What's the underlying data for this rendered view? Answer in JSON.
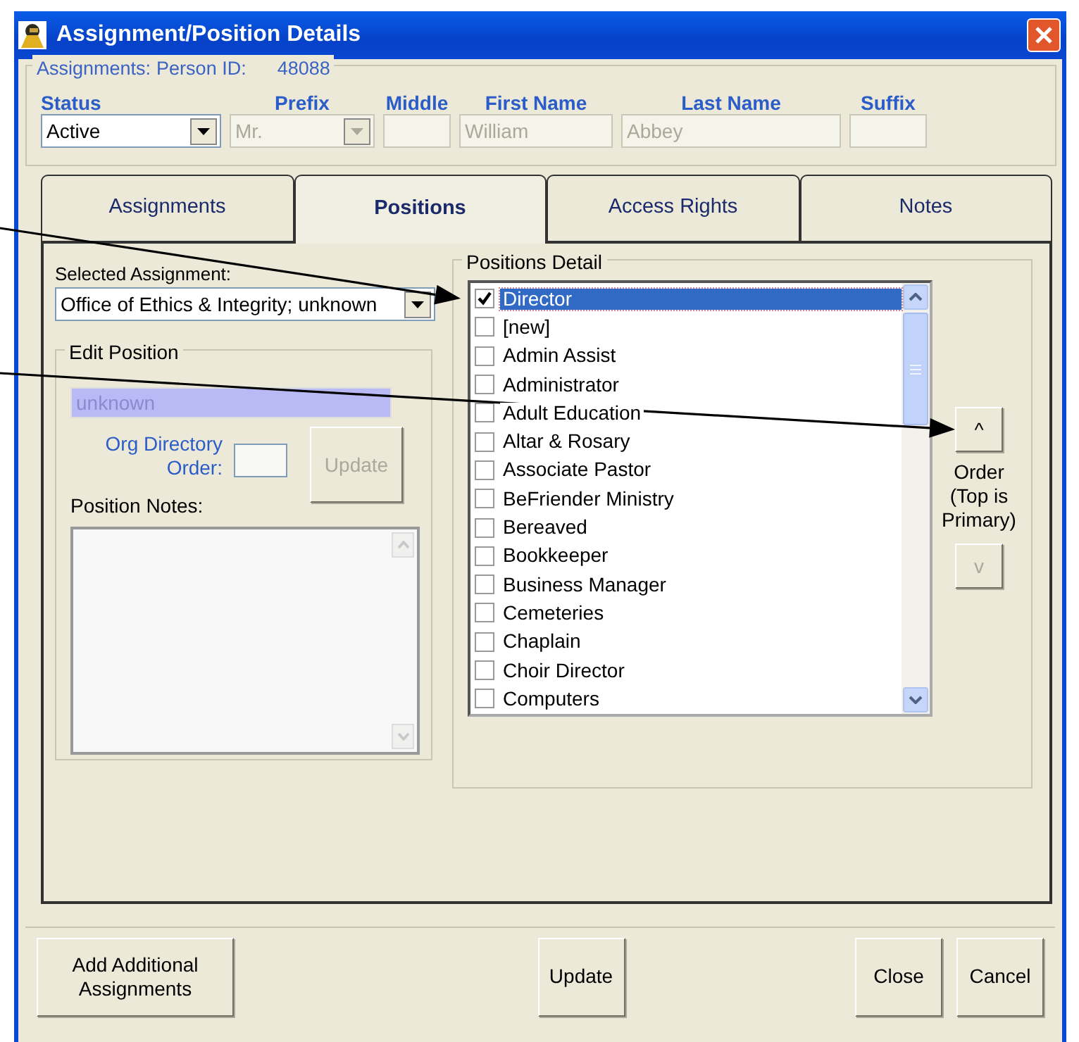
{
  "window": {
    "title": "Assignment/Position Details"
  },
  "header": {
    "legend": "Assignments:",
    "person_id_label": "Person ID:",
    "person_id": "48088"
  },
  "fields": [
    {
      "label": "Status",
      "kind": "select",
      "value": "Active",
      "disabled": false
    },
    {
      "label": "Prefix",
      "kind": "select",
      "value": "Mr.",
      "disabled": true
    },
    {
      "label": "Middle",
      "kind": "text",
      "disabled": true
    },
    {
      "label": "First Name",
      "kind": "text",
      "value": "William",
      "disabled": true
    },
    {
      "label": "Last Name",
      "kind": "text",
      "value": "Abbey",
      "disabled": true
    },
    {
      "label": "Suffix",
      "kind": "text",
      "disabled": true
    }
  ],
  "tabs": [
    {
      "label": "Assignments",
      "selected": false
    },
    {
      "label": "Positions",
      "selected": true
    },
    {
      "label": "Access Rights",
      "selected": false
    },
    {
      "label": "Notes",
      "selected": false
    }
  ],
  "selected_assignment": {
    "label": "Selected Assignment:",
    "value": "Office of Ethics & Integrity; unknown"
  },
  "edit_position": {
    "legend": "Edit Position",
    "position_name": "unknown",
    "org_order_label": "Org Directory Order:",
    "update_button": {
      "label": "Update",
      "disabled": true
    },
    "notes_label": "Position Notes:"
  },
  "positions_detail": {
    "legend": "Positions Detail",
    "items": [
      {
        "label": "Director",
        "checked": true,
        "selected": true
      },
      {
        "label": "[new]",
        "checked": false,
        "selected": false
      },
      {
        "label": "Admin Assist",
        "checked": false,
        "selected": false
      },
      {
        "label": "Administrator",
        "checked": false,
        "selected": false
      },
      {
        "label": "Adult Education",
        "checked": false,
        "selected": false
      },
      {
        "label": "Altar & Rosary",
        "checked": false,
        "selected": false
      },
      {
        "label": "Associate Pastor",
        "checked": false,
        "selected": false
      },
      {
        "label": "BeFriender Ministry",
        "checked": false,
        "selected": false
      },
      {
        "label": "Bereaved",
        "checked": false,
        "selected": false
      },
      {
        "label": "Bookkeeper",
        "checked": false,
        "selected": false
      },
      {
        "label": "Business Manager",
        "checked": false,
        "selected": false
      },
      {
        "label": "Cemeteries",
        "checked": false,
        "selected": false
      },
      {
        "label": "Chaplain",
        "checked": false,
        "selected": false
      },
      {
        "label": "Choir Director",
        "checked": false,
        "selected": false
      },
      {
        "label": "Computers",
        "checked": false,
        "selected": false
      }
    ]
  },
  "order": {
    "up": {
      "label": "^",
      "disabled": false
    },
    "caption": "Order (Top is Primary)",
    "down": {
      "label": "v",
      "disabled": true
    }
  },
  "footer_buttons": [
    {
      "label": "Add Additional Assignments",
      "kind": "left"
    },
    {
      "label": "Update",
      "kind": "center"
    },
    {
      "label": "Close",
      "kind": "right"
    },
    {
      "label": "Cancel",
      "kind": "right"
    }
  ]
}
